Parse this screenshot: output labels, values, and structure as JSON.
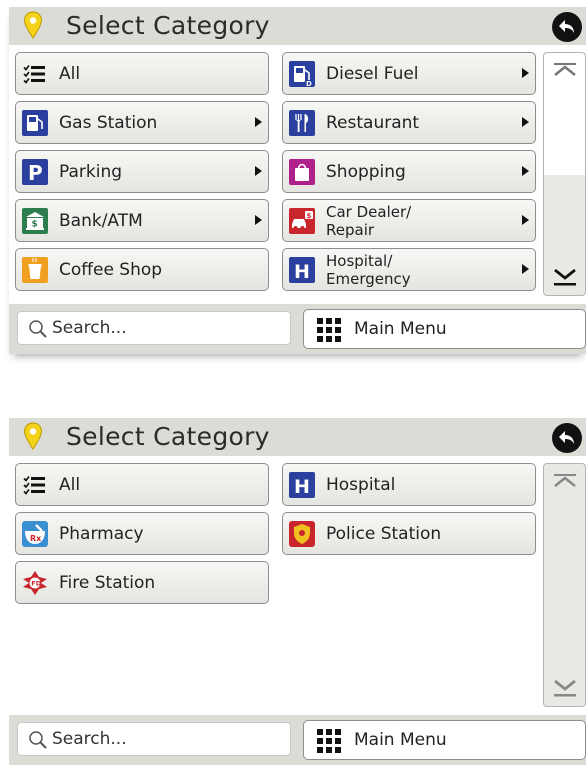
{
  "screen1": {
    "title": "Select Category",
    "items": [
      {
        "label": "All",
        "icon": "list-icon",
        "submenu": false
      },
      {
        "label": "Diesel Fuel",
        "icon": "diesel-fuel-icon",
        "submenu": true
      },
      {
        "label": "Gas Station",
        "icon": "gas-station-icon",
        "submenu": true
      },
      {
        "label": "Restaurant",
        "icon": "restaurant-icon",
        "submenu": true
      },
      {
        "label": "Parking",
        "icon": "parking-icon",
        "submenu": true
      },
      {
        "label": "Shopping",
        "icon": "shopping-icon",
        "submenu": true
      },
      {
        "label": "Bank/ATM",
        "icon": "bank-atm-icon",
        "submenu": true
      },
      {
        "label": "Car Dealer/ Repair",
        "line1": "Car Dealer/",
        "line2": "Repair",
        "icon": "car-dealer-icon",
        "submenu": true
      },
      {
        "label": "Coffee Shop",
        "icon": "coffee-icon",
        "submenu": false
      },
      {
        "label": "Hospital/ Emergency",
        "line1": "Hospital/",
        "line2": "Emergency",
        "icon": "hospital-icon",
        "submenu": true
      }
    ],
    "search_text": "Search...",
    "main_menu_label": "Main Menu"
  },
  "screen2": {
    "title": "Select Category",
    "items": [
      {
        "label": "All",
        "icon": "list-icon"
      },
      {
        "label": "Hospital",
        "icon": "hospital-icon"
      },
      {
        "label": "Pharmacy",
        "icon": "pharmacy-icon"
      },
      {
        "label": "Police Station",
        "icon": "police-badge-icon"
      },
      {
        "label": "Fire Station",
        "icon": "fire-station-icon"
      }
    ],
    "search_text": "Search...",
    "main_menu_label": "Main Menu"
  },
  "colors": {
    "header_bg": "#dcdcd6",
    "button_border": "#8e8e8e",
    "icon_blue": "#2a3f9e",
    "icon_purple": "#4b2a8f",
    "icon_green": "#2e7d4f",
    "icon_magenta": "#b0208a",
    "icon_red": "#c9252c",
    "icon_orange": "#f0a020",
    "pin_yellow": "#f5d21a"
  }
}
